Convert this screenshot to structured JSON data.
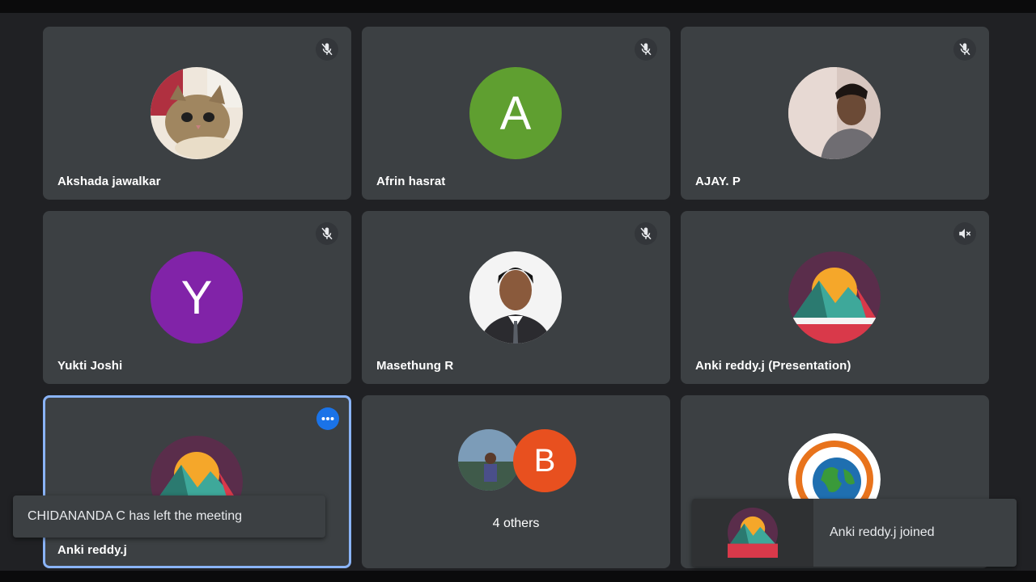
{
  "tiles": [
    {
      "name": "Akshada jawalkar",
      "avatar": "cat-photo",
      "muted": true
    },
    {
      "name": "Afrin hasrat",
      "avatar_letter": "A",
      "avatar_color": "#5f9f30",
      "muted": true
    },
    {
      "name": "AJAY. P",
      "avatar": "person-photo",
      "muted": true
    },
    {
      "name": "Yukti Joshi",
      "avatar_letter": "Y",
      "avatar_color": "#8123a8",
      "muted": true
    },
    {
      "name": "Masethung R",
      "avatar": "person-photo",
      "muted": true
    },
    {
      "name": "Anki reddy.j (Presentation)",
      "avatar": "mountain-logo",
      "volume_off": true
    },
    {
      "name": "Anki reddy.j",
      "avatar": "mountain-logo",
      "active_speaker": true
    },
    {
      "others_label": "4 others",
      "others_letter": "B",
      "others_letter_color": "#e8501f"
    },
    {
      "avatar": "globe-logo"
    }
  ],
  "toasts": {
    "left": "CHIDANANDA C has left the meeting",
    "right": "Anki reddy.j joined"
  },
  "colors": {
    "background": "#202124",
    "tile": "#3c4043",
    "active_border": "#8ab4f8",
    "accent": "#1a73e8"
  }
}
